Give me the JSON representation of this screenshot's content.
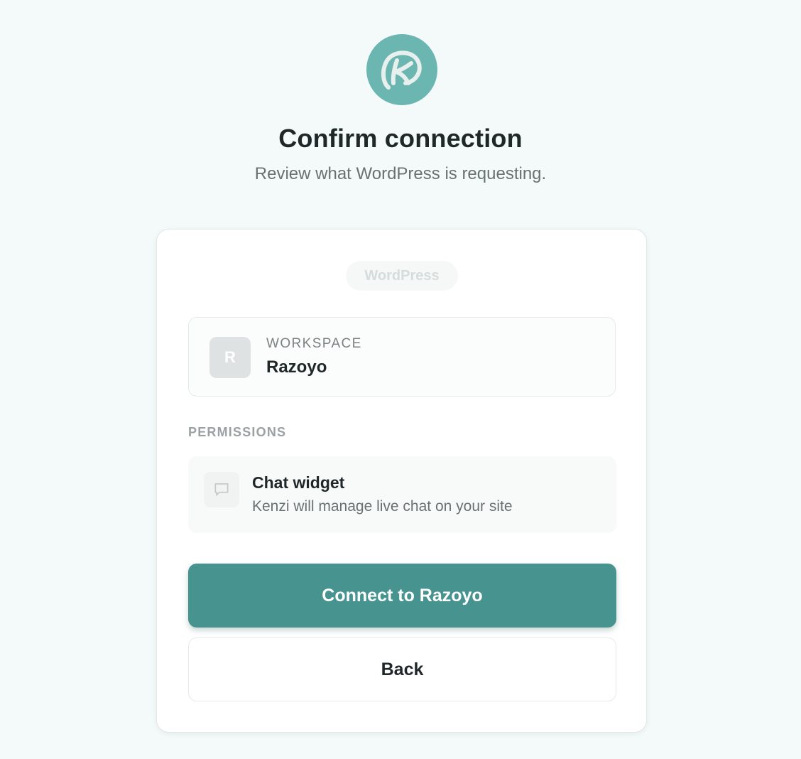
{
  "brand": {
    "icon": "kenzi-logo",
    "logo_color": "#6cb6b1"
  },
  "header": {
    "title": "Confirm connection",
    "subtitle": "Review what WordPress is requesting."
  },
  "card": {
    "app_pill": "WordPress",
    "workspace": {
      "avatar_letter": "R",
      "label": "WORKSPACE",
      "name": "Razoyo"
    },
    "permissions": {
      "heading": "PERMISSIONS",
      "items": [
        {
          "icon": "chat-bubble-icon",
          "title": "Chat widget",
          "description": "Kenzi will manage live chat on your site"
        }
      ]
    },
    "actions": {
      "connect_label": "Connect to Razoyo",
      "back_label": "Back"
    }
  },
  "colors": {
    "page_background": "#f3faf9",
    "accent": "#479390"
  }
}
